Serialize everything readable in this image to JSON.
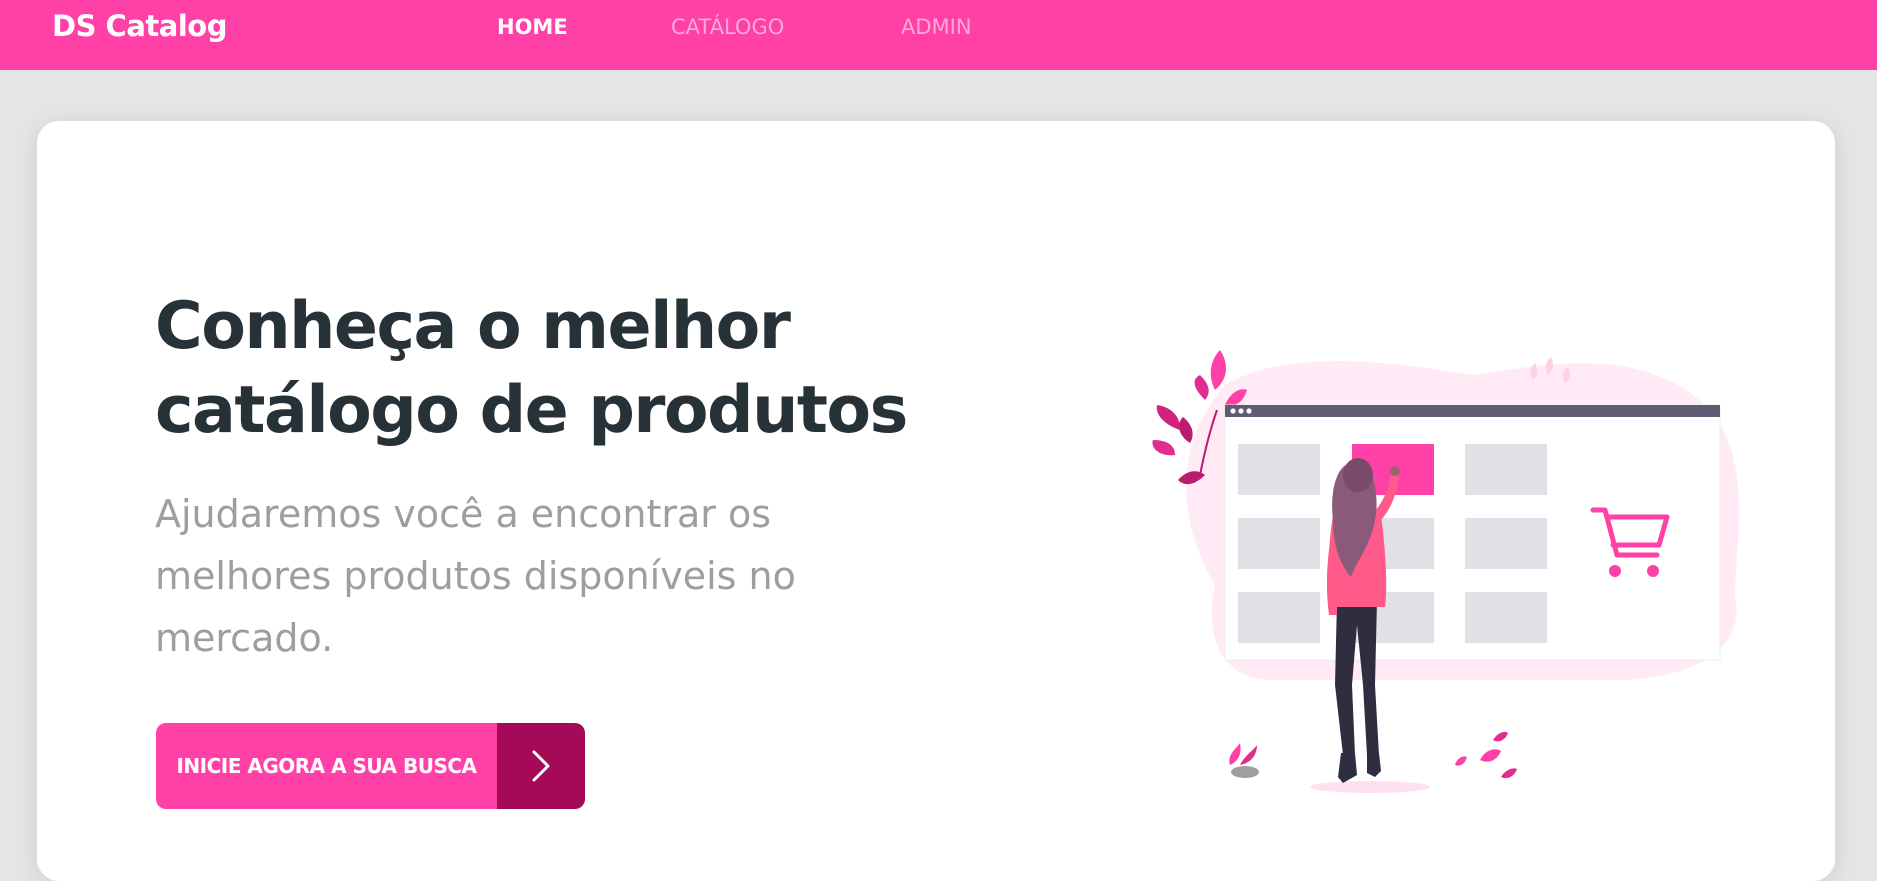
{
  "app": {
    "brand": "DS Catalog"
  },
  "nav": {
    "items": [
      {
        "label": "HOME",
        "active": true
      },
      {
        "label": "CATÁLOGO",
        "active": false
      },
      {
        "label": "ADMIN",
        "active": false
      }
    ]
  },
  "hero": {
    "title_line1": "Conheça o melhor",
    "title_line2": "catálogo de produtos",
    "subtitle": "Ajudaremos você a encontrar os melhores produtos disponíveis no mercado.",
    "cta_label": "INICIE AGORA A SUA BUSCA",
    "cta_icon": "chevron-right-icon",
    "illustration": "woman-shopping-catalog-illustration"
  },
  "colors": {
    "primary": "#ff40a7",
    "primary_dark": "#a50a58",
    "heading": "#263238",
    "subtitle": "#9e9e9e",
    "background": "#e5e5e5"
  }
}
